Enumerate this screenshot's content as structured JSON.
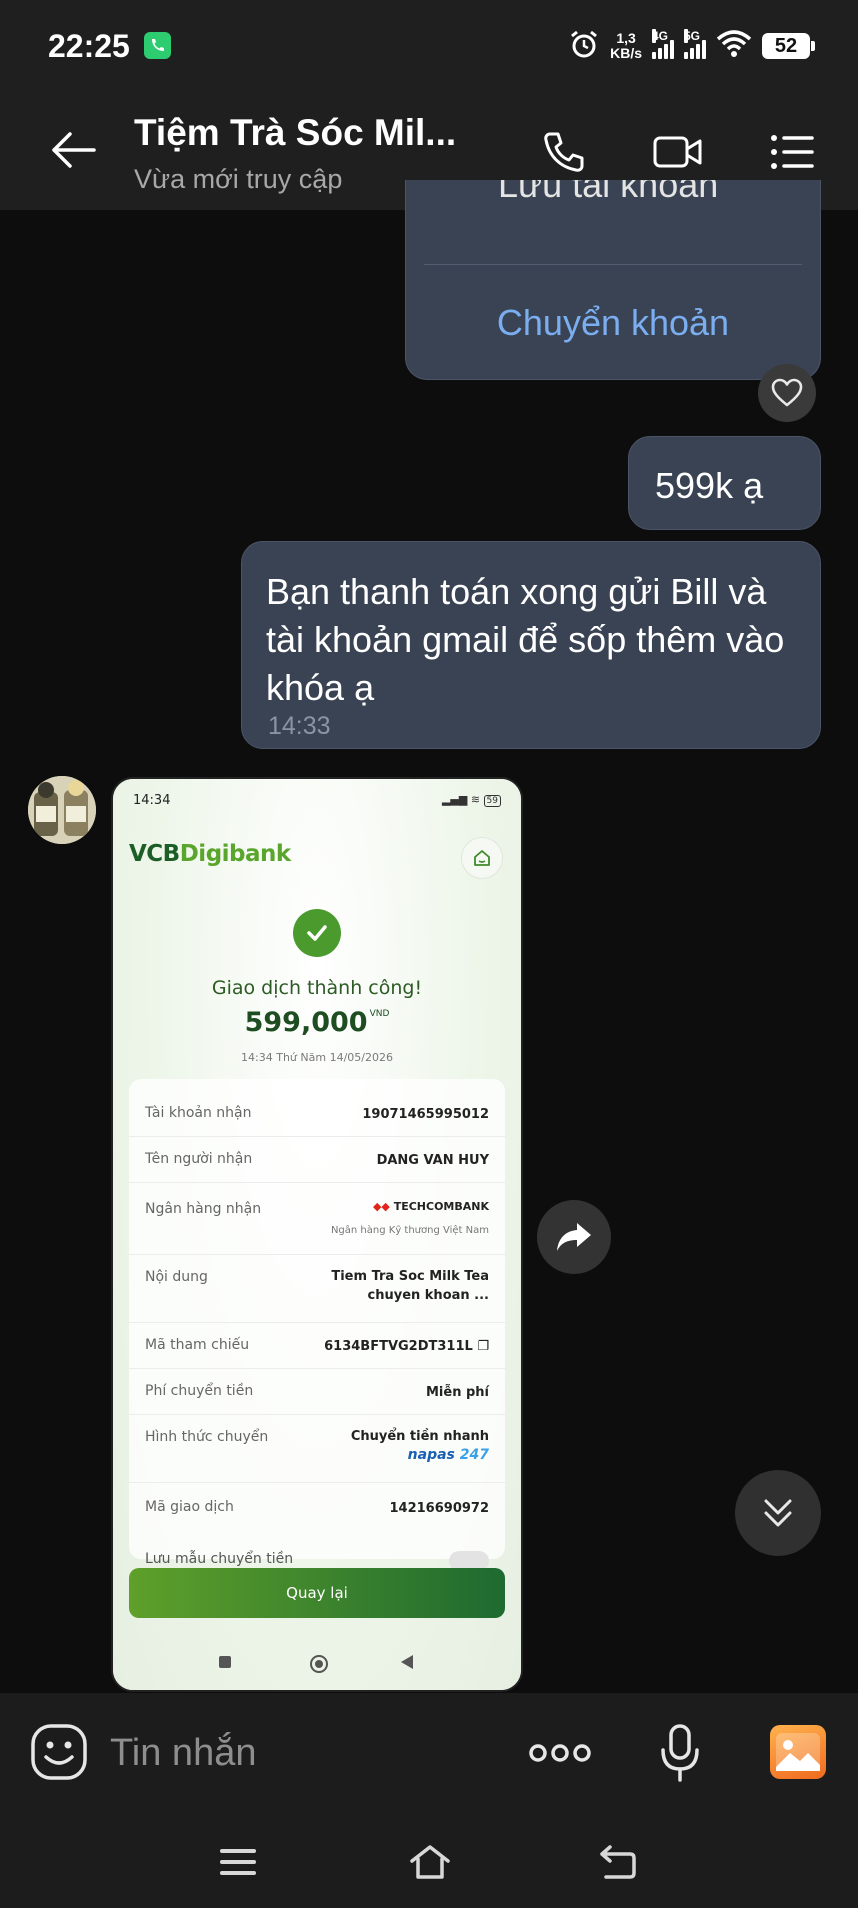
{
  "status_bar": {
    "time": "22:25",
    "net_speed_value": "1,3",
    "net_speed_unit": "KB/s",
    "sim1_label": "4G",
    "sim2_label": "5G",
    "battery": "52",
    "icons": [
      "call-notification-icon",
      "alarm-icon",
      "signal-icon",
      "wifi-icon",
      "battery-icon"
    ]
  },
  "header": {
    "title": "Tiệm Trà Sóc Mil...",
    "subtitle": "Vừa mới truy cập",
    "icons": [
      "back-arrow-icon",
      "phone-icon",
      "video-call-icon",
      "menu-icon"
    ]
  },
  "messages": {
    "partial_text": "Lưu tài khoản",
    "transfer_link": "Chuyển khoản",
    "price": "599k ạ",
    "payment_request": "Bạn thanh toán xong gửi Bill và tài khoản gmail để sốp thêm vào khóa ạ",
    "payment_request_time": "14:33"
  },
  "receipt": {
    "time": "14:34",
    "battery": "59",
    "logo_vcb": "VCB",
    "logo_digibank": "Digibank",
    "status": "Giao dịch thành công!",
    "amount": "599,000",
    "currency": "VND",
    "datetime": "14:34 Thứ Năm 14/05/2026",
    "rows": [
      {
        "label": "Tài khoản nhận",
        "value": "19071465995012"
      },
      {
        "label": "Tên người nhận",
        "value": "DANG VAN HUY"
      },
      {
        "label": "Ngân hàng nhận",
        "value": "TECHCOMBANK",
        "sub": "Ngân hàng Kỹ thương Việt Nam"
      },
      {
        "label": "Nội dung",
        "value": "Tiem Tra Soc Milk Tea",
        "value2": "chuyen khoan ..."
      },
      {
        "label": "Mã tham chiếu",
        "value": "6134BFTVG2DT311L"
      },
      {
        "label": "Phí chuyển tiền",
        "value": "Miễn phí"
      },
      {
        "label": "Hình thức chuyển",
        "value": "Chuyển tiền nhanh",
        "napas": "napas",
        "napas_num": "247"
      },
      {
        "label": "Mã giao dịch",
        "value": "14216690972"
      }
    ],
    "save_template": "Lưu mẫu chuyển tiền",
    "back_button": "Quay lại"
  },
  "input_bar": {
    "placeholder": "Tin nhắn",
    "icons": [
      "emoji-icon",
      "more-icon",
      "microphone-icon",
      "gallery-icon"
    ]
  },
  "nav_bar": {
    "icons": [
      "recent-apps-icon",
      "home-icon",
      "back-icon"
    ]
  },
  "colors": {
    "bubble": "#3a4353",
    "link": "#7aaef0",
    "background": "#0d0d0d",
    "vcb_green": "#1d5e26"
  }
}
